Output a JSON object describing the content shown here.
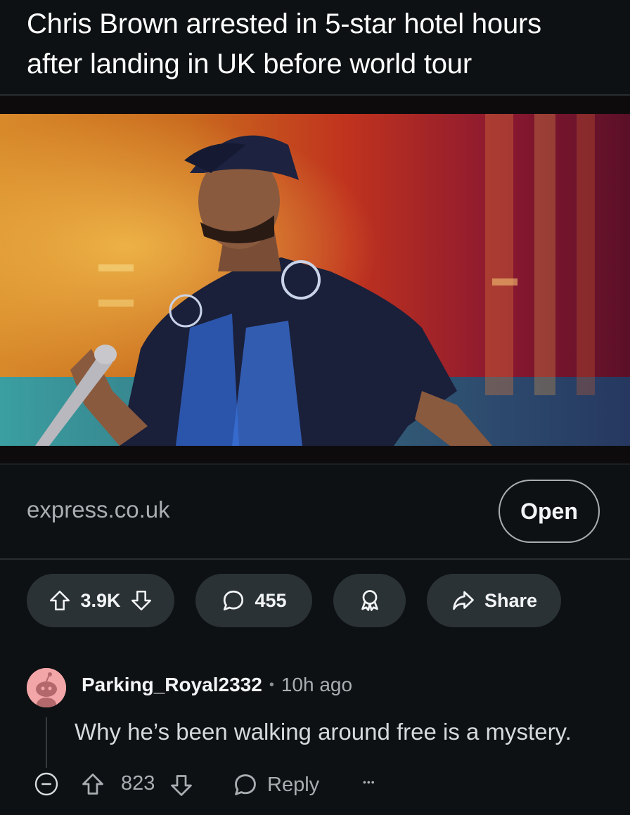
{
  "post": {
    "title": "Chris Brown arrested in 5-star hotel hours after landing in UK before world tour",
    "link_domain": "express.co.uk",
    "open_label": "Open",
    "image_alt": "Performer in cap and jersey holding a microphone on stage"
  },
  "actions": {
    "votes": "3.9K",
    "comments": "455",
    "share_label": "Share"
  },
  "comment": {
    "author": "Parking_Royal2332",
    "separator": "•",
    "time": "10h ago",
    "body": "Why he’s been walking around free is a mystery.",
    "votes": "823",
    "reply_label": "Reply",
    "more_label": "•••"
  },
  "colors": {
    "background": "#0e1113",
    "pill": "#2a3236",
    "muted_text": "#a8aeb2",
    "avatar": "#f3a6a8"
  }
}
